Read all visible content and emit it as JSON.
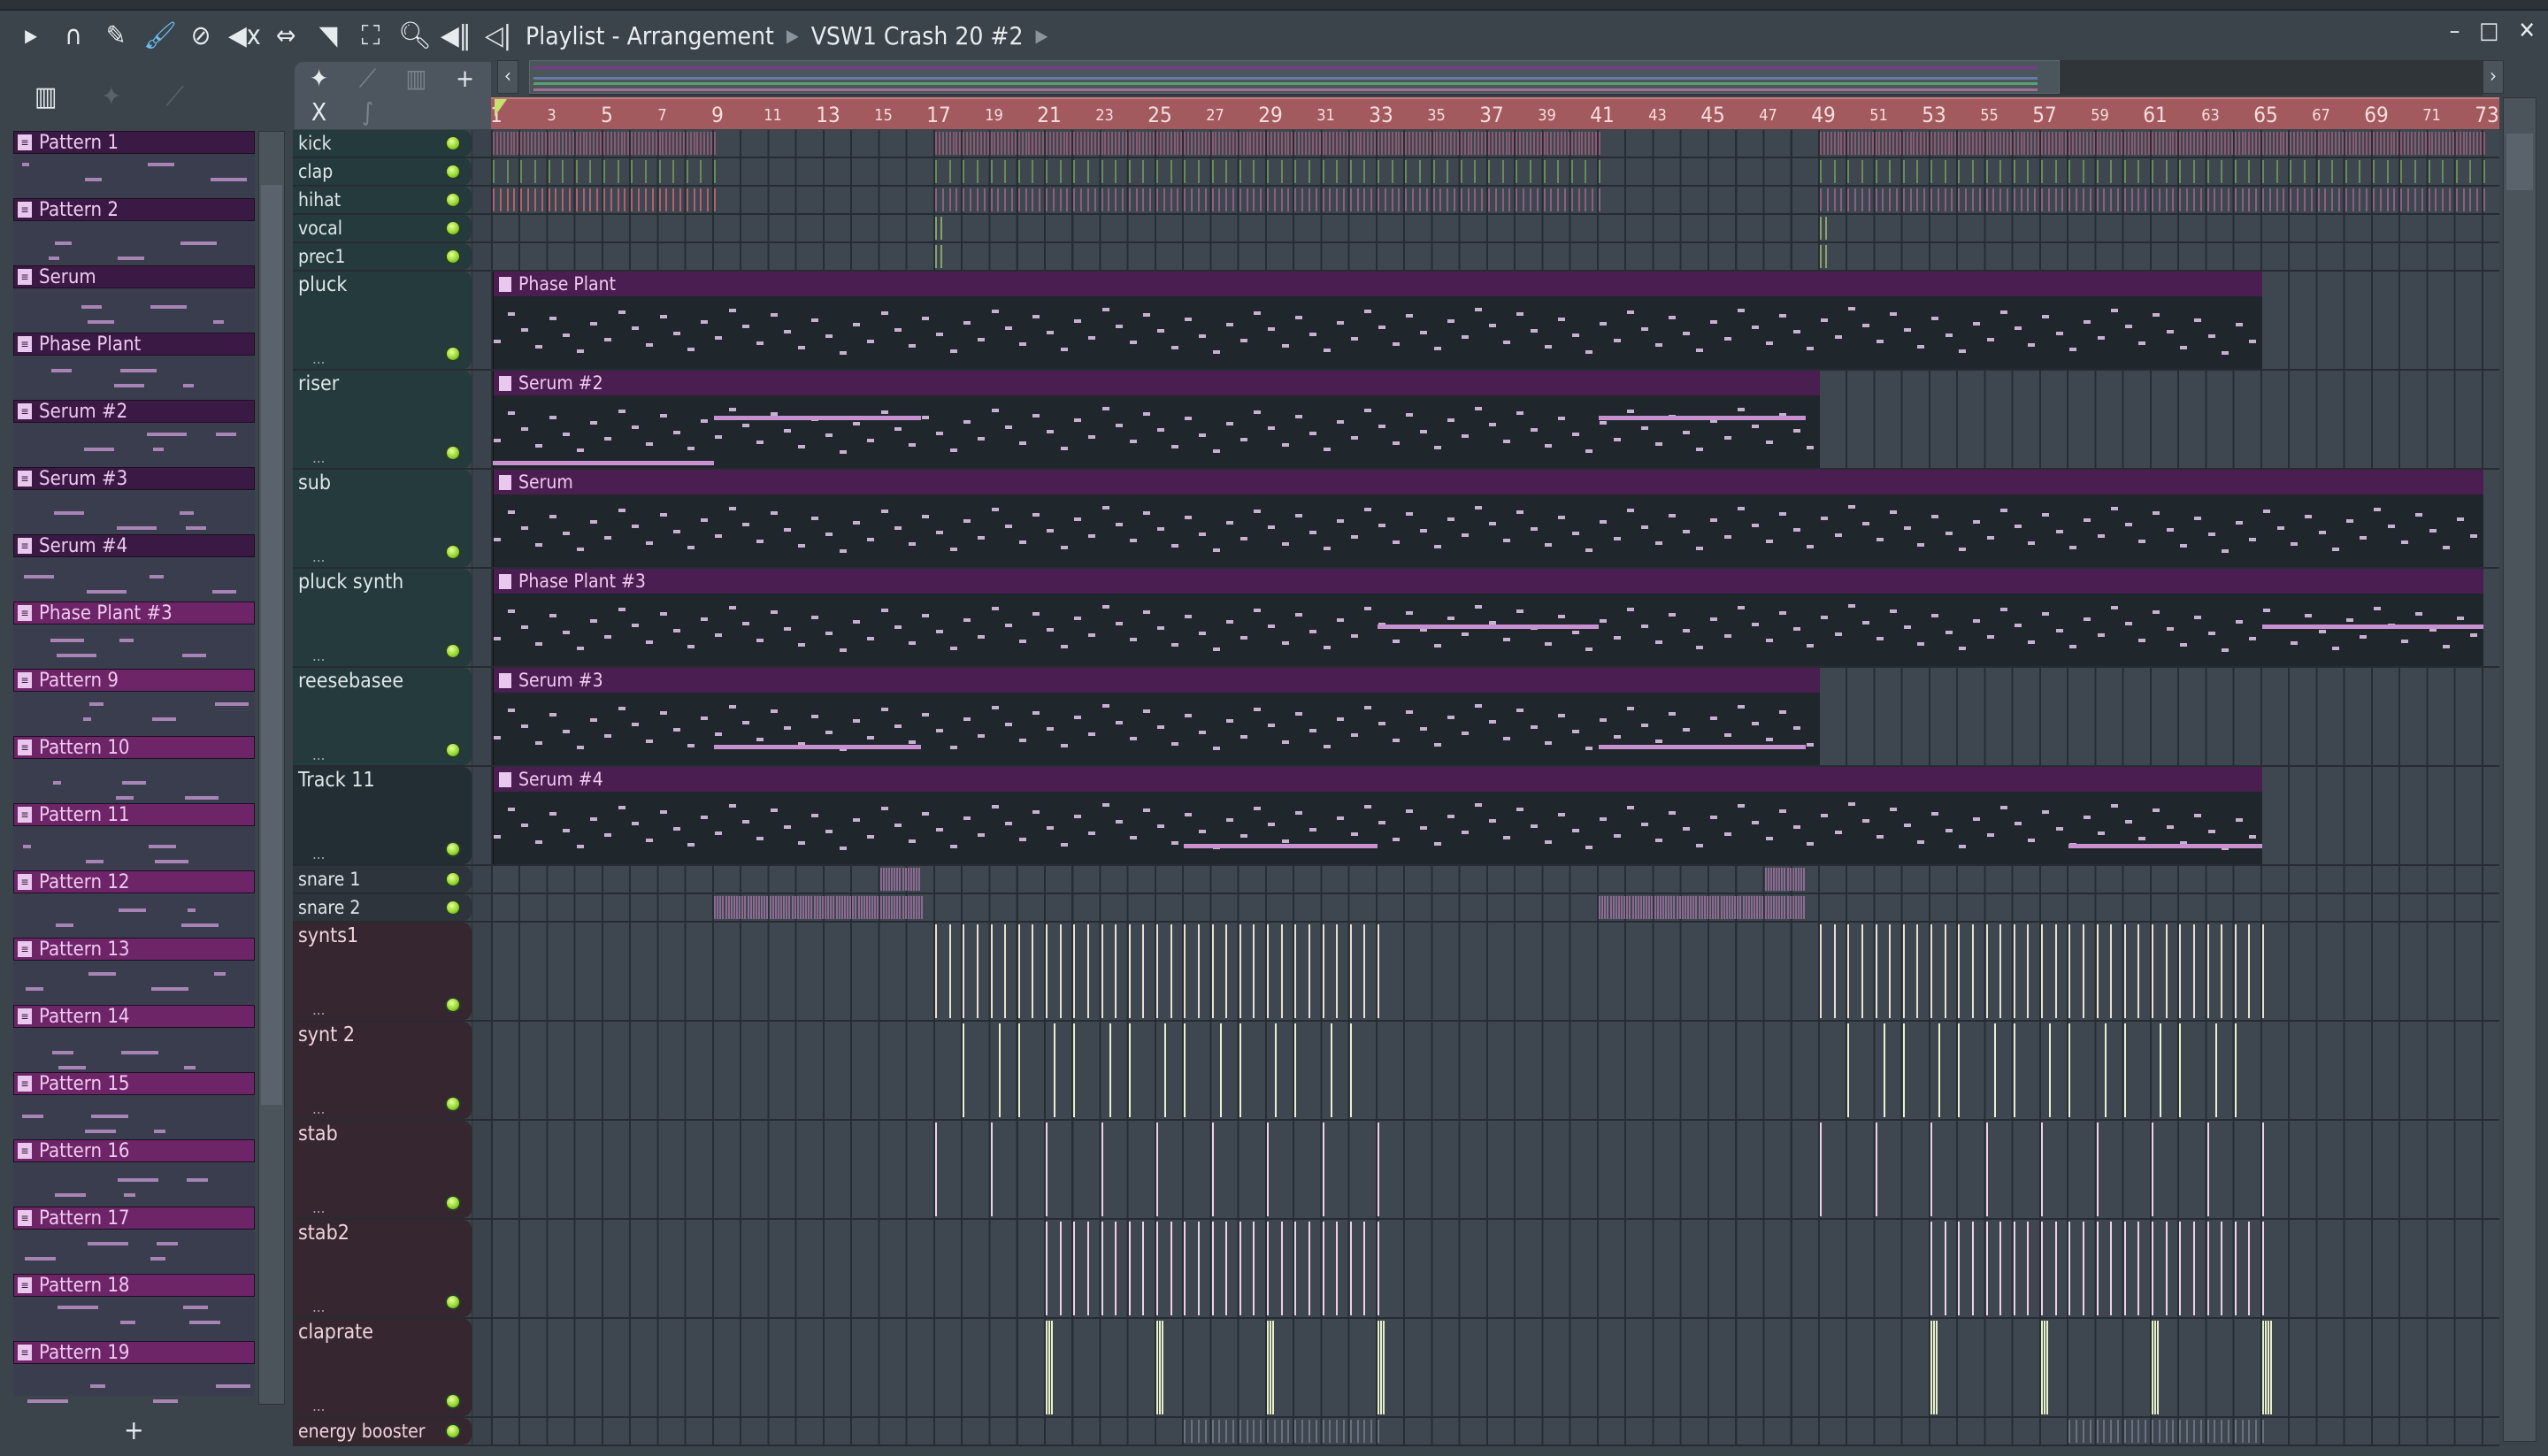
{
  "window": {
    "breadcrumb": [
      "Playlist - Arrangement",
      "VSW1 Crash 20 #2"
    ],
    "controls": [
      "minimize",
      "maximize",
      "close"
    ]
  },
  "toolbar": {
    "icons": [
      "play-arrow-icon",
      "magnet-icon",
      "pencil-icon",
      "paint-brush-icon",
      "delete-icon",
      "mute-icon",
      "slip-icon",
      "slice-icon",
      "select-icon",
      "zoom-icon",
      "playback-icon",
      "speaker-icon"
    ]
  },
  "picker": {
    "add_label": "+",
    "items": [
      "Pattern 1",
      "Pattern 2",
      "Serum",
      "Phase Plant",
      "Serum #2",
      "Serum #3",
      "Serum #4",
      "Phase Plant #3",
      "Pattern 9",
      "Pattern 10",
      "Pattern 11",
      "Pattern 12",
      "Pattern 13",
      "Pattern 14",
      "Pattern 15",
      "Pattern 16",
      "Pattern 17",
      "Pattern 18",
      "Pattern 19"
    ]
  },
  "track_tools": {
    "add": "+",
    "close": "X"
  },
  "ruler": {
    "bars": [
      1,
      3,
      5,
      7,
      9,
      11,
      13,
      15,
      17,
      19,
      21,
      23,
      25,
      27,
      29,
      31,
      33,
      35,
      37,
      39,
      41,
      43,
      45,
      47,
      49,
      51,
      53,
      55,
      57,
      59,
      61,
      63,
      65,
      67,
      69,
      71,
      73
    ]
  },
  "colors": {
    "ruler": "#a35a5e",
    "clip_header": "#4a1e50",
    "led": "#8fd42a"
  },
  "tracks": [
    {
      "name": "kick",
      "size": "small",
      "theme": "teal",
      "marks": [
        [
          1,
          9,
          0.125,
          "#8a5a72"
        ],
        [
          17,
          41,
          0.125,
          "#8a5a72"
        ],
        [
          49,
          73,
          0.125,
          "#8a5a72"
        ]
      ]
    },
    {
      "name": "clap",
      "size": "small",
      "theme": "teal",
      "marks": [
        [
          1,
          9,
          0.5,
          "#6a8a5a"
        ],
        [
          17,
          41,
          0.5,
          "#6a8a5a"
        ],
        [
          49,
          73,
          0.5,
          "#6a8a5a"
        ]
      ]
    },
    {
      "name": "hihat",
      "size": "small",
      "theme": "teal",
      "marks": [
        [
          1,
          9,
          0.25,
          "#b06070"
        ],
        [
          17,
          41,
          0.25,
          "#8a6080"
        ],
        [
          49,
          73,
          0.25,
          "#8a6080"
        ]
      ]
    },
    {
      "name": "vocal",
      "size": "small",
      "theme": "teal",
      "marks": [
        [
          17,
          17.3,
          0.2,
          "#8aa070"
        ],
        [
          49,
          49.3,
          0.2,
          "#8aa070"
        ]
      ]
    },
    {
      "name": "prec1",
      "size": "small",
      "theme": "teal",
      "marks": [
        [
          17,
          17.3,
          0.2,
          "#8aa070"
        ],
        [
          49,
          49.3,
          0.2,
          "#8aa070"
        ]
      ]
    },
    {
      "name": "pluck",
      "size": "big",
      "theme": "teal",
      "clips": [
        {
          "label": "Phase Plant",
          "start": 1,
          "end": 65
        }
      ]
    },
    {
      "name": "riser",
      "size": "big",
      "theme": "teal",
      "clips": [
        {
          "label": "Serum #2",
          "start": 1,
          "end": 49
        }
      ],
      "bars": [
        [
          9,
          16.5,
          0.3
        ],
        [
          41,
          48.5,
          0.3
        ],
        [
          1,
          9,
          0.95
        ]
      ]
    },
    {
      "name": "sub",
      "size": "big",
      "theme": "teal",
      "clips": [
        {
          "label": "Serum",
          "start": 1,
          "end": 73
        }
      ]
    },
    {
      "name": "pluck synth",
      "size": "big",
      "theme": "teal",
      "clips": [
        {
          "label": "Phase Plant #3",
          "start": 1,
          "end": 73
        }
      ],
      "bars": [
        [
          33,
          41,
          0.45
        ],
        [
          65,
          73,
          0.45
        ]
      ]
    },
    {
      "name": "reesebasee",
      "size": "big",
      "theme": "teal",
      "clips": [
        {
          "label": "Serum #3",
          "start": 1,
          "end": 49
        }
      ],
      "bars": [
        [
          9,
          16.5,
          0.75
        ],
        [
          41,
          48.5,
          0.75
        ]
      ]
    },
    {
      "name": "Track 11",
      "size": "big",
      "theme": "dark",
      "clips": [
        {
          "label": "Serum #4",
          "start": 1,
          "end": 65
        }
      ],
      "bars": [
        [
          26,
          33,
          0.75
        ],
        [
          58,
          65,
          0.75
        ]
      ]
    },
    {
      "name": "snare 1",
      "size": "small",
      "theme": "slate",
      "marks": [
        [
          15,
          16.5,
          0.1,
          "#8a6a90"
        ],
        [
          47,
          48.5,
          0.1,
          "#8a6a90"
        ]
      ]
    },
    {
      "name": "snare 2",
      "size": "small",
      "theme": "slate",
      "marks": [
        [
          9,
          16.5,
          0.1,
          "#8a6a90"
        ],
        [
          41,
          48.5,
          0.1,
          "#8a6a90"
        ]
      ]
    },
    {
      "name": "synts1",
      "size": "big",
      "theme": "maroon",
      "marks": [
        [
          17,
          33,
          1,
          "#e8e0d0"
        ],
        [
          49,
          65,
          1,
          "#e8e0d0"
        ],
        [
          17.5,
          33,
          1,
          "#e8e0d0"
        ],
        [
          49.5,
          65,
          1,
          "#e8e0d0"
        ]
      ]
    },
    {
      "name": "synt 2",
      "size": "big",
      "theme": "maroon",
      "marks": [
        [
          18,
          33,
          2,
          "#e8f0d0"
        ],
        [
          50,
          65,
          2,
          "#e8f0d0"
        ],
        [
          19.3,
          33,
          2,
          "#e8f0d0"
        ],
        [
          51.3,
          65,
          2,
          "#e8f0d0"
        ]
      ]
    },
    {
      "name": "stab",
      "size": "big",
      "theme": "maroon",
      "marks": [
        [
          17,
          33.1,
          2,
          "#f0d0e8"
        ],
        [
          49,
          65.1,
          2,
          "#f0d0e8"
        ]
      ]
    },
    {
      "name": "stab2",
      "size": "big",
      "theme": "maroon",
      "marks": [
        [
          21,
          33,
          0.5,
          "#f0d0e8"
        ],
        [
          53,
          65,
          0.5,
          "#f0d0e8"
        ]
      ]
    },
    {
      "name": "claprate",
      "size": "big",
      "theme": "maroon",
      "marks": [
        [
          21,
          21.3,
          0.1,
          "#e8f0c8"
        ],
        [
          25,
          25.3,
          0.1,
          "#e8f0c8"
        ],
        [
          29,
          29.3,
          0.1,
          "#e8f0c8"
        ],
        [
          33,
          33.3,
          0.1,
          "#e8f0c8"
        ],
        [
          53,
          53.3,
          0.1,
          "#e8f0c8"
        ],
        [
          57,
          57.3,
          0.1,
          "#e8f0c8"
        ],
        [
          61,
          61.3,
          0.1,
          "#e8f0c8"
        ],
        [
          65,
          65.3,
          0.1,
          "#e8f0c8"
        ]
      ]
    },
    {
      "name": "energy booster",
      "size": "small",
      "theme": "maroon",
      "marks": [
        [
          26,
          33,
          0.25,
          "#6a7080"
        ],
        [
          58,
          65,
          0.25,
          "#6a7080"
        ]
      ]
    }
  ]
}
